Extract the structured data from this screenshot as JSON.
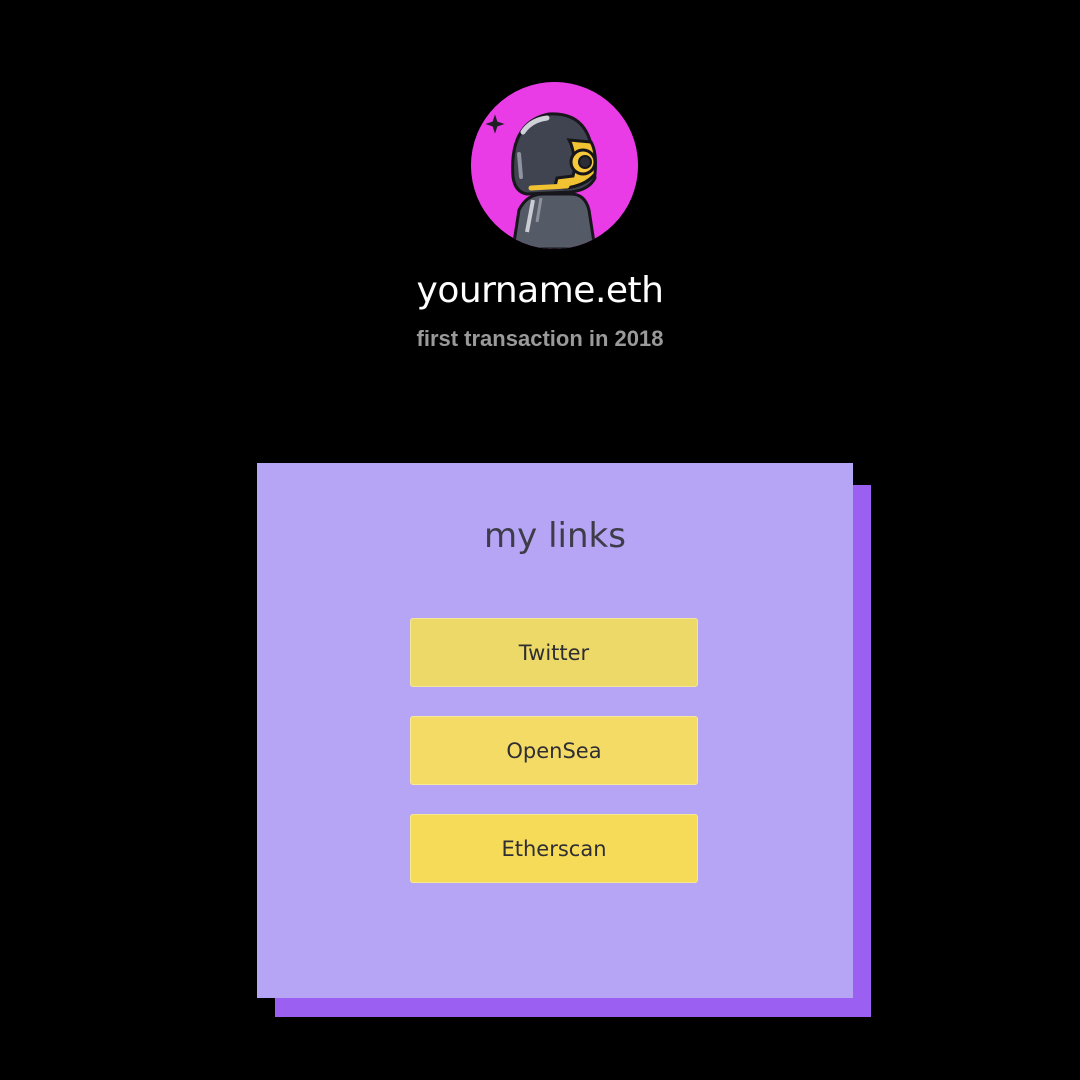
{
  "profile": {
    "avatar_icon": "helmet-robot-icon",
    "name": "yourname.eth",
    "subtitle": "first transaction in 2018"
  },
  "links_card": {
    "title": "my links",
    "links": [
      {
        "label": "Twitter",
        "color": "#ecd967"
      },
      {
        "label": "OpenSea",
        "color": "#f3db66"
      },
      {
        "label": "Etherscan",
        "color": "#f5db58"
      }
    ]
  },
  "colors": {
    "background": "#000000",
    "avatar_bg": "#e93be6",
    "card": "#b6a5f4",
    "card_shadow": "#9b5ff1",
    "subtitle": "#9a9a9a"
  }
}
